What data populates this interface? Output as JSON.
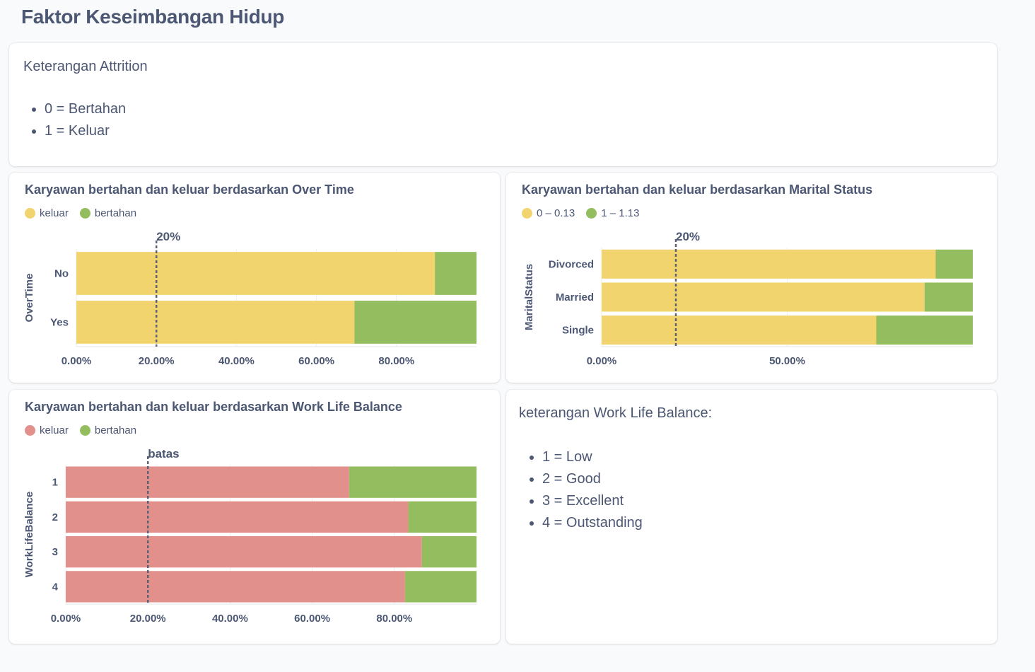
{
  "page": {
    "title": "Faktor Keseimbangan Hidup"
  },
  "attrition_card": {
    "title": "Keterangan Attrition",
    "items": [
      "0 = Bertahan",
      "1 = Keluar"
    ]
  },
  "wlb_card": {
    "title": "keterangan Work Life Balance:",
    "items": [
      "1 = Low",
      "2 = Good",
      "3 = Excellent",
      "4 = Outstanding"
    ]
  },
  "colors": {
    "yellow": "#f2d46f",
    "green": "#93bd5e",
    "red": "#e2908c"
  },
  "chart_data": [
    {
      "type": "bar",
      "orientation": "horizontal",
      "stacked": true,
      "title": "Karyawan bertahan dan keluar berdasarkan Over Time",
      "ylabel": "OverTime",
      "categories": [
        "No",
        "Yes"
      ],
      "series": [
        {
          "name": "keluar",
          "color": "#f2d46f",
          "values": [
            0.896,
            0.695
          ]
        },
        {
          "name": "bertahan",
          "color": "#93bd5e",
          "values": [
            0.104,
            0.305
          ]
        }
      ],
      "xticks": [
        "0.00%",
        "20.00%",
        "40.00%",
        "60.00%",
        "80.00%"
      ],
      "xlim": [
        0,
        1
      ],
      "reference_line": {
        "value": 0.2,
        "label": "20%"
      }
    },
    {
      "type": "bar",
      "orientation": "horizontal",
      "stacked": true,
      "title": "Karyawan bertahan dan keluar berdasarkan Marital Status",
      "ylabel": "MaritalStatus",
      "categories": [
        "Divorced",
        "Married",
        "Single"
      ],
      "series": [
        {
          "name": "0 – 0.13",
          "color": "#f2d46f",
          "values": [
            0.9,
            0.87,
            0.74
          ]
        },
        {
          "name": "1 – 1.13",
          "color": "#93bd5e",
          "values": [
            0.1,
            0.13,
            0.26
          ]
        }
      ],
      "xticks": [
        "0.00%",
        "50.00%"
      ],
      "xlim": [
        0,
        1
      ],
      "reference_line": {
        "value": 0.2,
        "label": "20%"
      }
    },
    {
      "type": "bar",
      "orientation": "horizontal",
      "stacked": true,
      "title": "Karyawan bertahan dan keluar berdasarkan Work Life Balance",
      "ylabel": "WorkLifeBalance",
      "categories": [
        "1",
        "2",
        "3",
        "4"
      ],
      "series": [
        {
          "name": "keluar",
          "color": "#e2908c",
          "values": [
            0.69,
            0.834,
            0.867,
            0.826
          ]
        },
        {
          "name": "bertahan",
          "color": "#93bd5e",
          "values": [
            0.31,
            0.166,
            0.133,
            0.174
          ]
        }
      ],
      "xticks": [
        "0.00%",
        "20.00%",
        "40.00%",
        "60.00%",
        "80.00%"
      ],
      "xlim": [
        0,
        1
      ],
      "reference_line": {
        "value": 0.2,
        "label": "batas"
      }
    }
  ]
}
